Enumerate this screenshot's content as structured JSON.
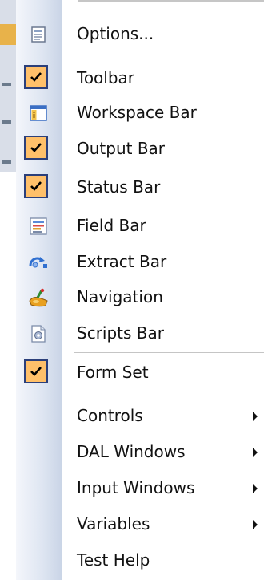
{
  "menu": {
    "items": [
      {
        "label": "Options...",
        "icon": "options-icon",
        "checked": false,
        "submenu": false
      },
      {
        "label": "Toolbar",
        "icon": "check-icon",
        "checked": true,
        "submenu": false
      },
      {
        "label": "Workspace Bar",
        "icon": "workspace-bar-icon",
        "checked": false,
        "submenu": false
      },
      {
        "label": "Output Bar",
        "icon": "check-icon",
        "checked": true,
        "submenu": false
      },
      {
        "label": "Status Bar",
        "icon": "check-icon",
        "checked": true,
        "submenu": false
      },
      {
        "label": "Field Bar",
        "icon": "field-bar-icon",
        "checked": false,
        "submenu": false
      },
      {
        "label": "Extract Bar",
        "icon": "extract-bar-icon",
        "checked": false,
        "submenu": false
      },
      {
        "label": "Navigation",
        "icon": "navigation-icon",
        "checked": false,
        "submenu": false
      },
      {
        "label": "Scripts Bar",
        "icon": "scripts-bar-icon",
        "checked": false,
        "submenu": false
      },
      {
        "label": "Form Set",
        "icon": "check-icon",
        "checked": true,
        "submenu": false
      },
      {
        "label": "Controls",
        "icon": "",
        "checked": false,
        "submenu": true
      },
      {
        "label": "DAL Windows",
        "icon": "",
        "checked": false,
        "submenu": true
      },
      {
        "label": "Input Windows",
        "icon": "",
        "checked": false,
        "submenu": true
      },
      {
        "label": "Variables",
        "icon": "",
        "checked": false,
        "submenu": true
      },
      {
        "label": "Test Help",
        "icon": "",
        "checked": false,
        "submenu": false
      }
    ]
  },
  "colors": {
    "check_bg": "#ffc06a",
    "check_border": "#2b3f7a",
    "check_mark": "#000000",
    "gutter": "#dfe6f2",
    "separator": "#c5c5c5"
  }
}
